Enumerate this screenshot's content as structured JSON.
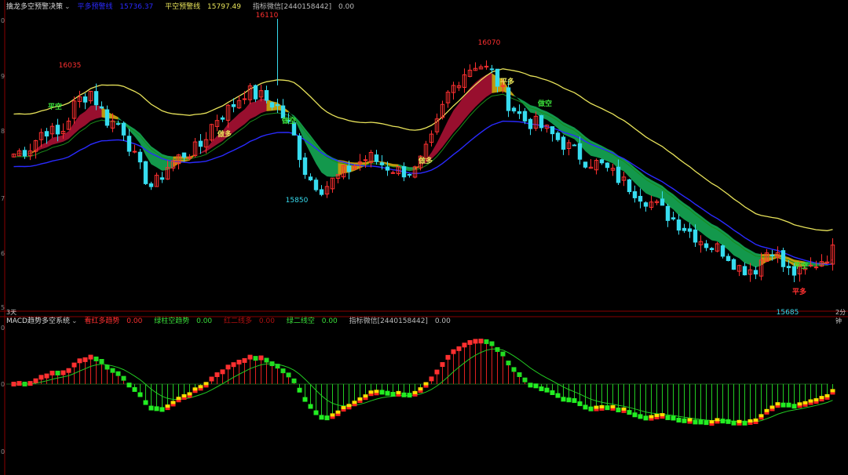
{
  "top_legend": {
    "title": "擒龙多空预警决策",
    "title_color": "#d8d8d8",
    "item1_label": "平多预警线",
    "item1_value": "15736.37",
    "item1_color": "#2a2aff",
    "item2_label": "平空预警线",
    "item2_value": "15797.49",
    "item2_color": "#e8e35a",
    "item3_label": "指标微信[2440158442]",
    "item3_value": "0.00",
    "item3_color": "#bbbbbb"
  },
  "bottom_legend": {
    "title": "MACD趋势多空系统",
    "title_color": "#d8d8d8",
    "item1_label": "看红多趋势",
    "item1_value": "0.00",
    "item1_color": "#ff3030",
    "item2_label": "绿柱空趋势",
    "item2_value": "0.00",
    "item2_color": "#3adf3a",
    "item3_label": "红二线多",
    "item3_value": "0.00",
    "item3_color": "#b01010",
    "item4_label": "绿二线空",
    "item4_value": "0.00",
    "item4_color": "#3adf3a",
    "item5_label": "指标微信[2440158442]",
    "item5_value": "0.00",
    "item5_color": "#bbbbbb"
  },
  "period_label": "3天",
  "right_label": "2分钟",
  "colors": {
    "up": "#ff3030",
    "down": "#37dcef",
    "yellow_line": "#e8e35a",
    "blue_line": "#2a2aff",
    "green_line": "#1a8a1a",
    "band_green": "#14a050",
    "band_gold": "#c9a20e",
    "band_red": "#a01030",
    "macd_red": "#e02020",
    "macd_green": "#22cc22"
  },
  "chart_data": [
    {
      "type": "candlestick",
      "title": "擒龙多空预警决策",
      "annotations": [
        {
          "text": "16035",
          "color": "#ff3030"
        },
        {
          "text": "16110",
          "color": "#ff3030"
        },
        {
          "text": "15850",
          "color": "#37dcef"
        },
        {
          "text": "16070",
          "color": "#ff3030"
        },
        {
          "text": "15685",
          "color": "#37dcef"
        }
      ],
      "signals": [
        {
          "text": "平空",
          "color": "#3adf3a"
        },
        {
          "text": "做多",
          "color": "#e8e35a"
        },
        {
          "text": "做空",
          "color": "#3adf3a"
        },
        {
          "text": "做多",
          "color": "#e8e35a"
        },
        {
          "text": "平多",
          "color": "#e8e35a"
        },
        {
          "text": "做空",
          "color": "#3adf3a"
        },
        {
          "text": "平空",
          "color": "#3adf3a"
        },
        {
          "text": "平多",
          "color": "#ff3030"
        }
      ],
      "yticks": [
        "0",
        "9",
        "8",
        "7",
        "6",
        "5"
      ],
      "xlabels": [
        "3天",
        "2分钟"
      ],
      "close_path": [
        15900,
        15910,
        15945,
        15930,
        15990,
        16010,
        15960,
        15950,
        15880,
        15840,
        15880,
        15900,
        15910,
        15960,
        15980,
        16010,
        16000,
        15985,
        15940,
        15860,
        15840,
        15860,
        15880,
        15895,
        15880,
        15870,
        15870,
        15920,
        16000,
        16040,
        16060,
        16040,
        15990,
        15960,
        15950,
        15930,
        15910,
        15890,
        15880,
        15860,
        15840,
        15820,
        15800,
        15780,
        15760,
        15740,
        15730,
        15700,
        15700,
        15740,
        15695,
        15690,
        15710,
        15730
      ]
    },
    {
      "type": "bar",
      "title": "MACD趋势多空系统",
      "zero_line": 0,
      "note": "MACD histogram with signal lines; red bars above zero, green bars below zero"
    }
  ]
}
